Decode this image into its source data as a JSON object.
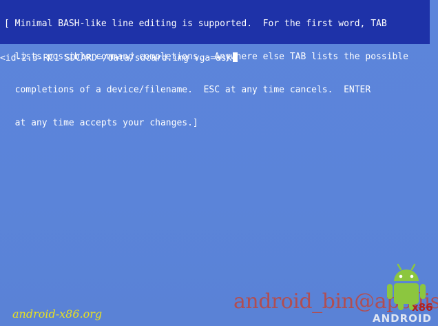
{
  "help": {
    "lines": [
      "[ Minimal BASH-like line editing is supported.  For the first word, TAB",
      "  lists possible command completions.  Anywhere else TAB lists the possible",
      "  completions of a device/filename.  ESC at any time cancels.  ENTER",
      "  at any time accepts your changes.]"
    ]
  },
  "command": {
    "text": "<id-2.3-RC1 SDCARD=/data/sdcard.img vga=ask"
  },
  "footer": {
    "site": "android-x86.org",
    "watermark": "android_bin@apollis",
    "logo_word": "ANDROID",
    "logo_badge": "x86"
  },
  "colors": {
    "background": "#5b84d9",
    "help_box": "#1e32a8",
    "site_text": "#e8e020",
    "android_green": "#8cc63f"
  }
}
